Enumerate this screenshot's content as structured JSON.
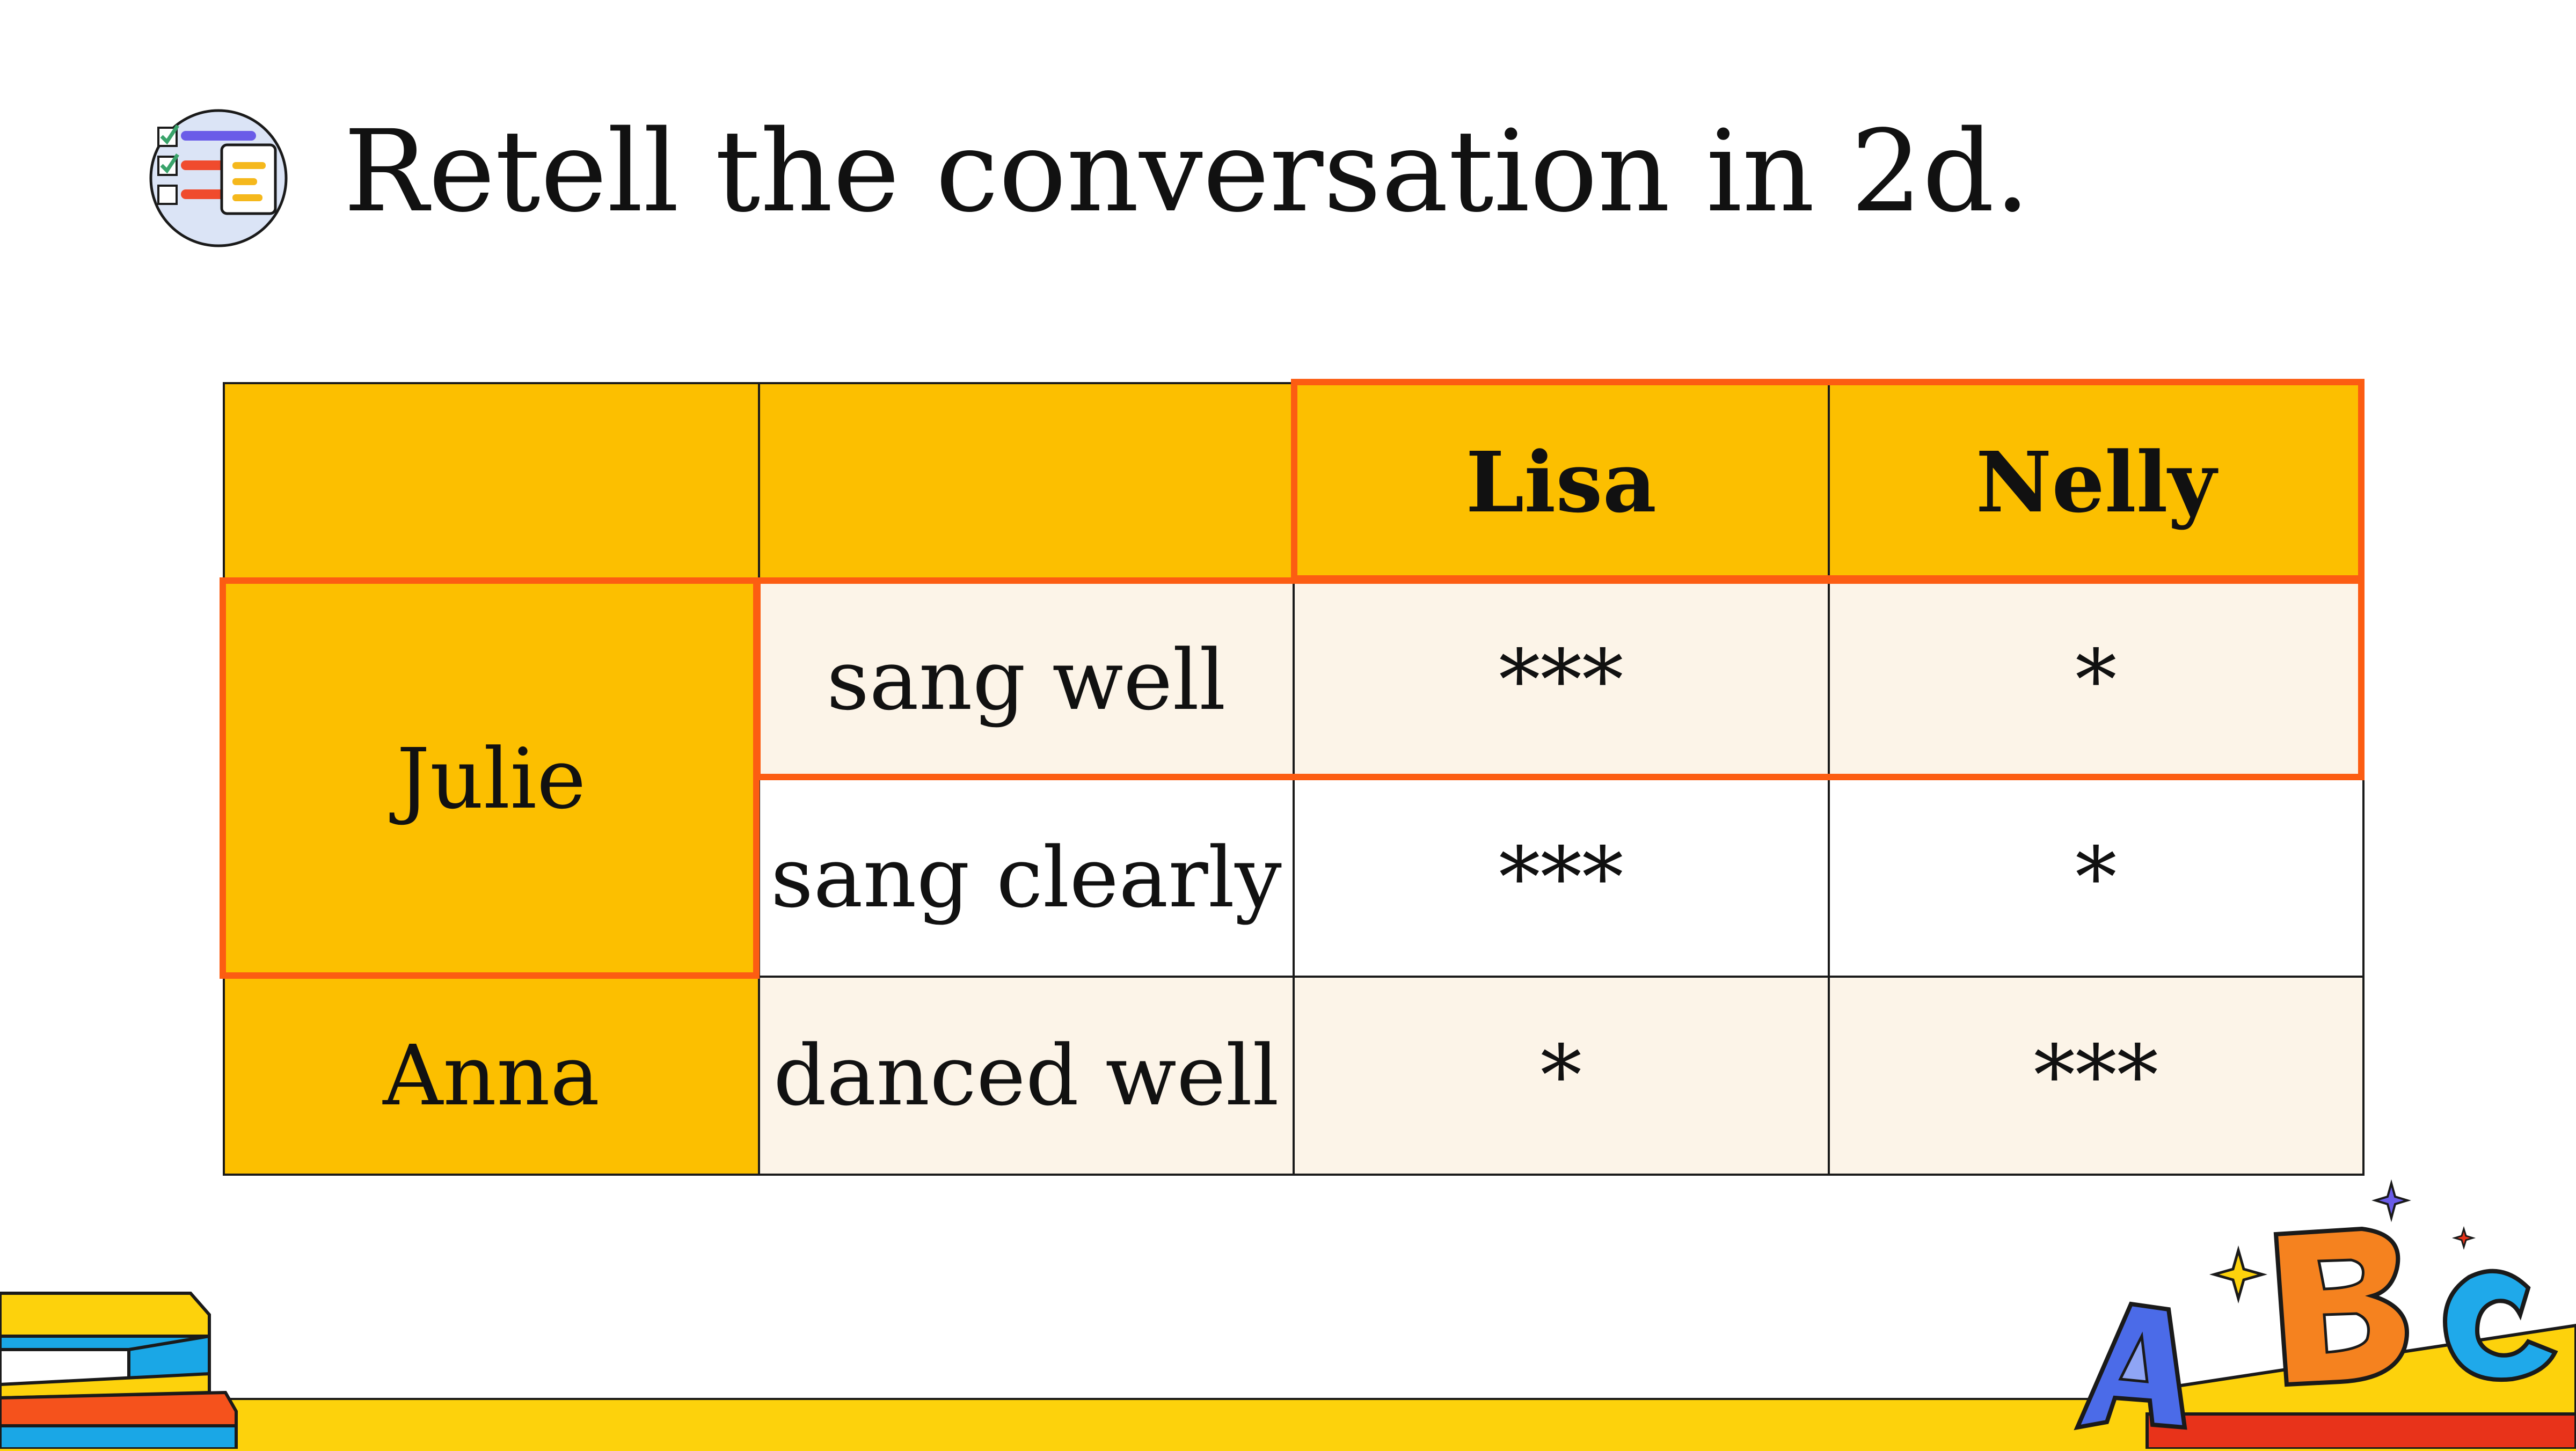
{
  "header": {
    "title": "Retell the conversation in 2d.",
    "icon": "checklist-icon"
  },
  "table": {
    "columns": [
      "",
      "",
      "Lisa",
      "Nelly"
    ],
    "rows": [
      {
        "person": "Julie",
        "activity": "sang well",
        "lisa": "***",
        "nelly": "*"
      },
      {
        "person": "",
        "activity": "sang clearly",
        "lisa": "***",
        "nelly": "*"
      },
      {
        "person": "Anna",
        "activity": "danced well",
        "lisa": "*",
        "nelly": "***"
      }
    ]
  },
  "decorations": {
    "bottom_left": "stacked-books-illustration",
    "bottom_right": "abc-letters-illustration"
  },
  "colors": {
    "header_fill": "#fcbf00",
    "highlight_border": "#fc5d12",
    "cell_cream": "#fcf4e8",
    "bottom_strip": "#fdd20c"
  }
}
